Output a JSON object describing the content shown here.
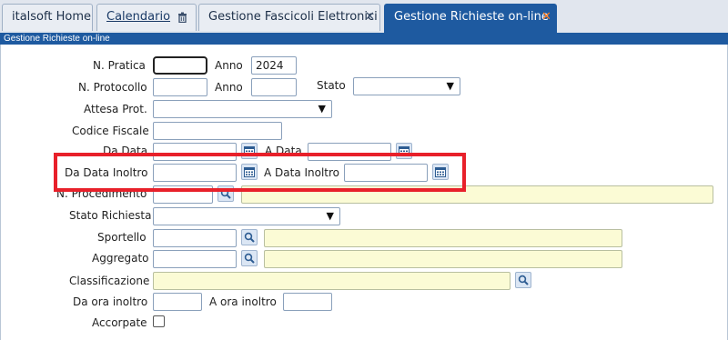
{
  "tabs": [
    {
      "label": "italsoft Home"
    },
    {
      "label": "Calendario"
    },
    {
      "label": "Gestione Fascicoli Elettronici"
    },
    {
      "label": "Gestione Richieste on-line"
    }
  ],
  "window": {
    "title": "Gestione Richieste on-line"
  },
  "form": {
    "n_pratica_label": "N. Pratica",
    "anno_label": "Anno",
    "anno_value": "2024",
    "n_protocollo_label": "N. Protocollo",
    "anno2_label": "Anno",
    "stato_label": "Stato",
    "attesa_prot_label": "Attesa Prot.",
    "codice_fiscale_label": "Codice Fiscale",
    "da_data_label": "Da Data",
    "a_data_label": "A Data",
    "da_data_inoltro_label": "Da Data Inoltro",
    "a_data_inoltro_label": "A Data Inoltro",
    "n_procedimento_label": "N. Procedimento",
    "stato_richiesta_label": "Stato Richiesta",
    "sportello_label": "Sportello",
    "aggregato_label": "Aggregato",
    "classificazione_label": "Classificazione",
    "da_ora_inoltro_label": "Da ora inoltro",
    "a_ora_inoltro_label": "A ora inoltro",
    "accorpate_label": "Accorpate"
  },
  "colors": {
    "accent": "#1e5aa0",
    "highlight": "#e8202a",
    "lookup_field": "#fbfbd5"
  },
  "icons": {
    "calendar": "calendar-icon",
    "search": "search-icon",
    "trash": "trash-icon",
    "close": "close-icon"
  }
}
